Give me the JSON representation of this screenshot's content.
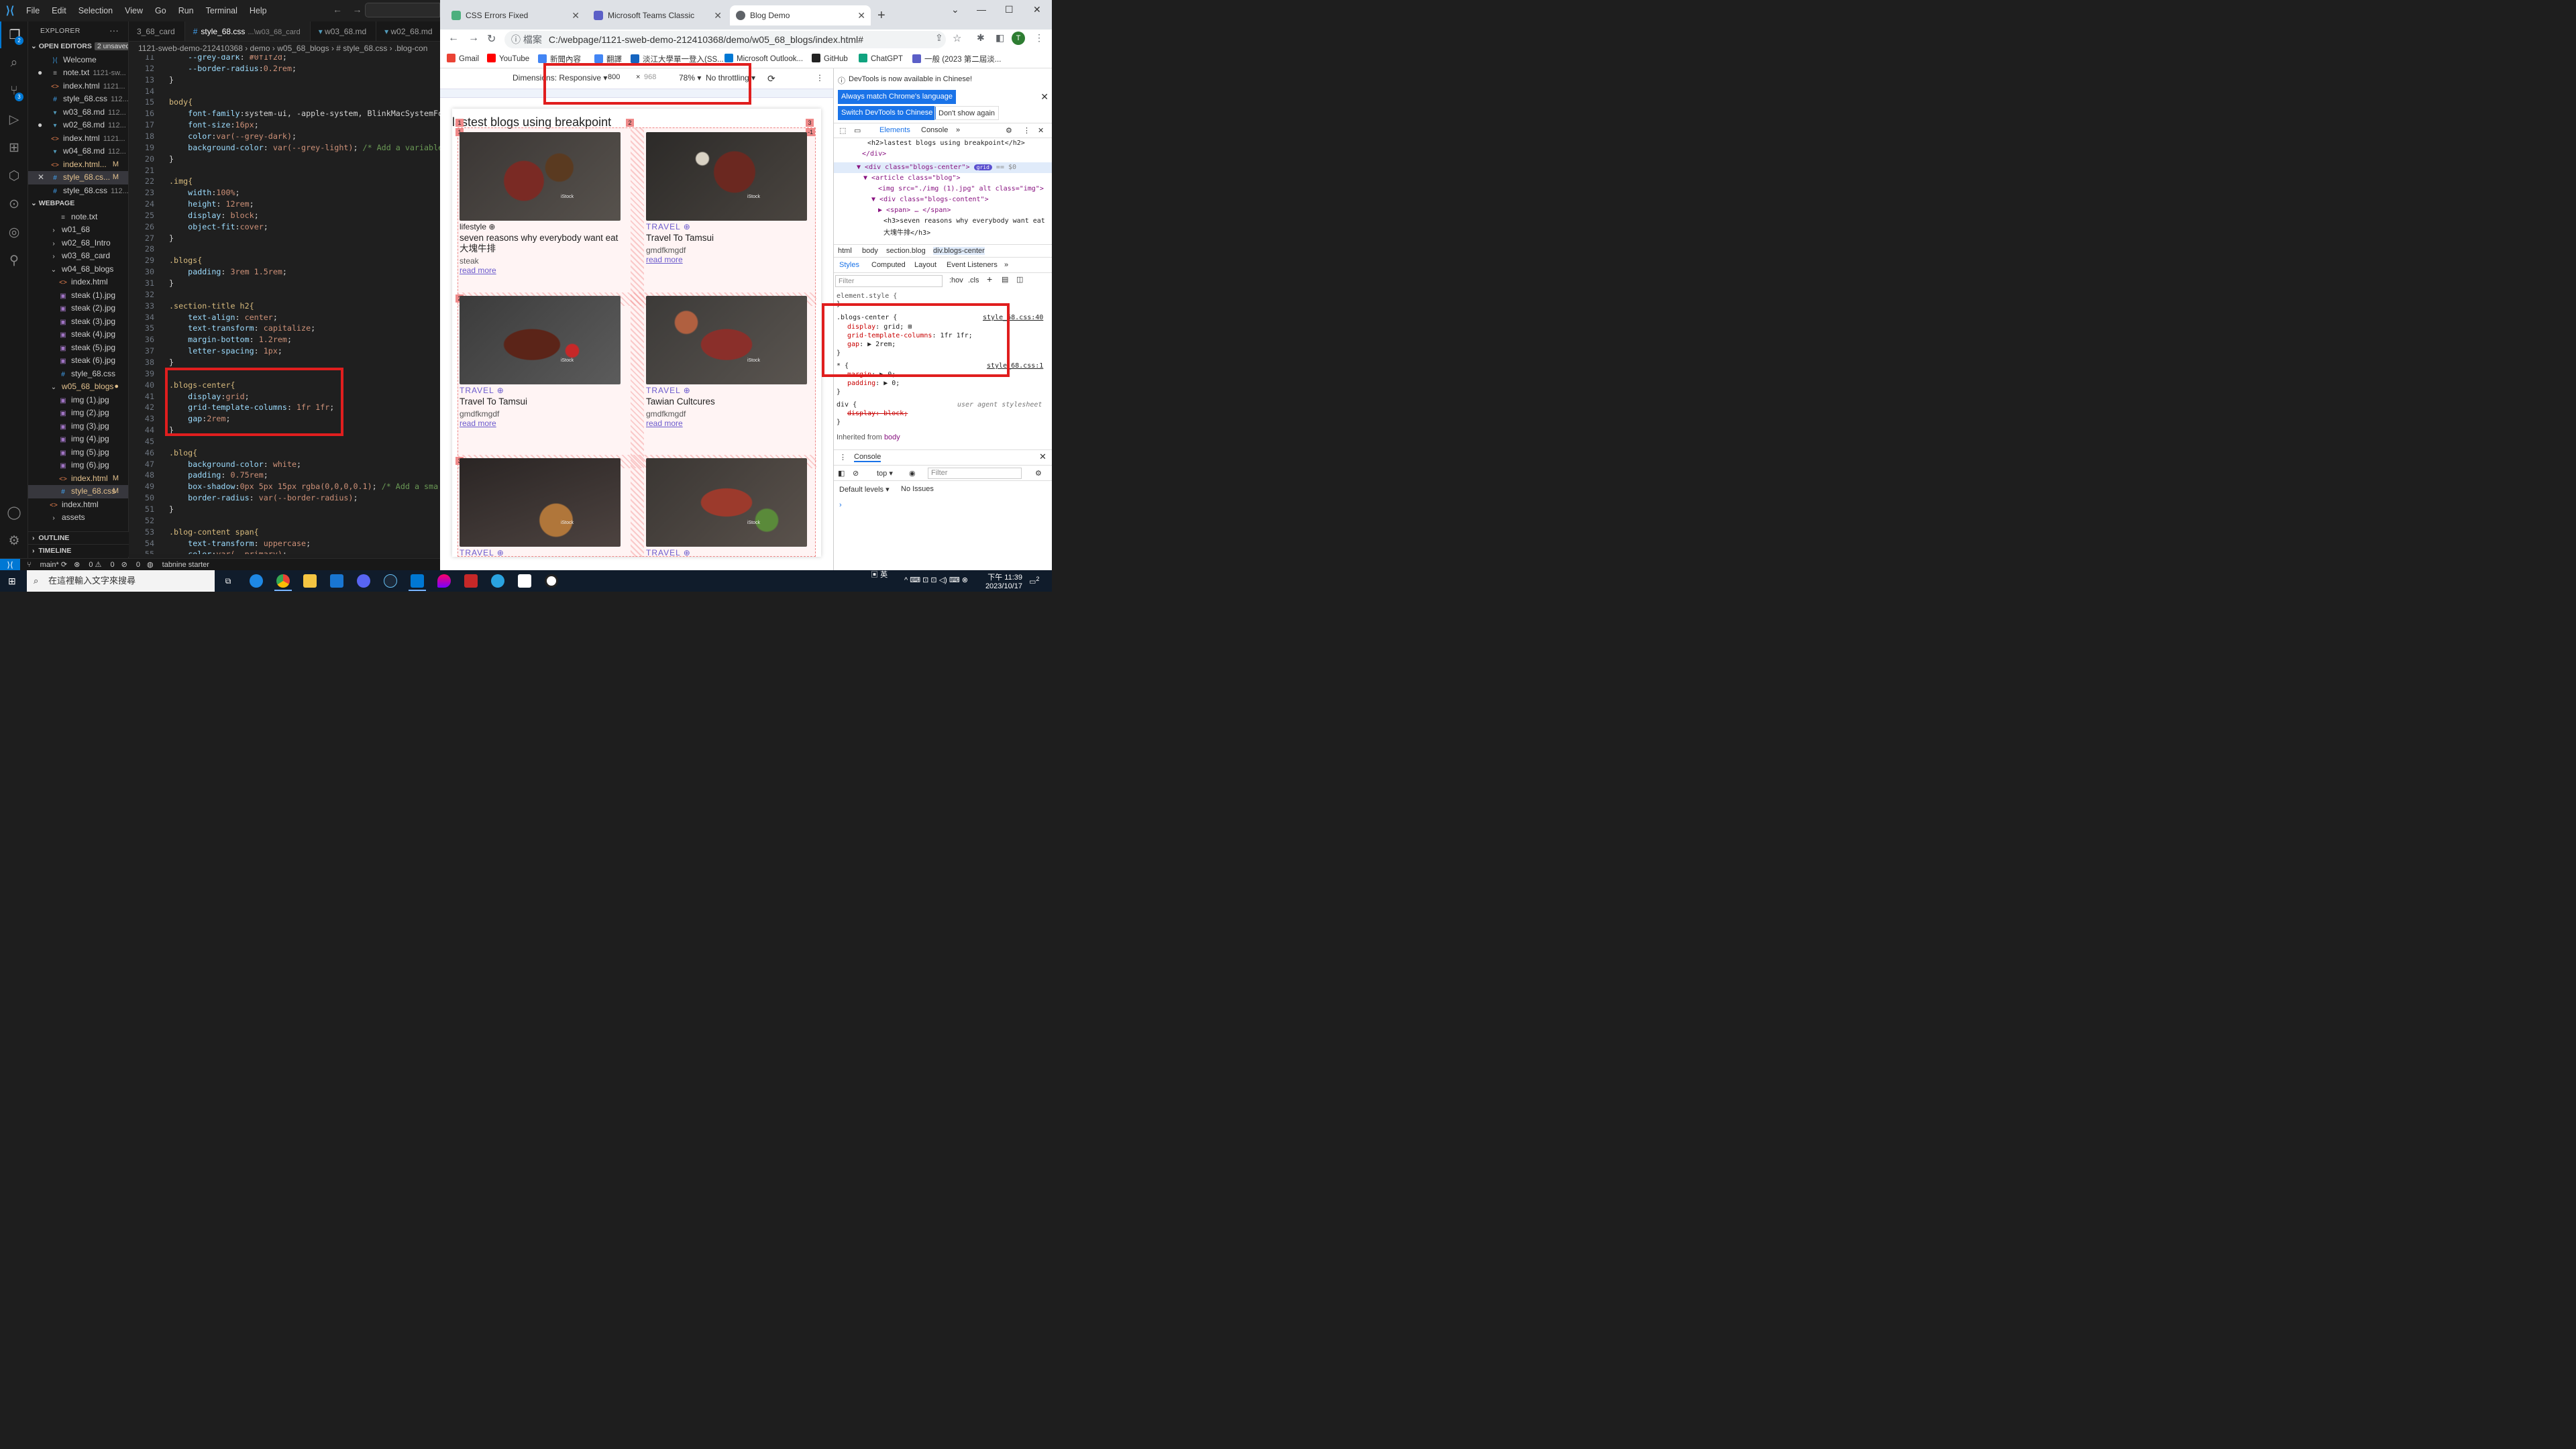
{
  "vscode": {
    "menu": [
      "File",
      "Edit",
      "Selection",
      "View",
      "Go",
      "Run",
      "Terminal",
      "Help"
    ],
    "explorer": {
      "title": "EXPLORER",
      "open_editors_label": "OPEN EDITORS",
      "unsaved_label": "2 unsaved",
      "open_editors": [
        {
          "name": "Welcome",
          "icon": "vscode-icon",
          "desc": "",
          "status": ""
        },
        {
          "name": "note.txt",
          "icon": "txt-icon",
          "desc": "1121-sw...",
          "status": ""
        },
        {
          "name": "index.html",
          "icon": "html-icon",
          "desc": "1121...",
          "status": ""
        },
        {
          "name": "style_68.css",
          "icon": "css-icon",
          "desc": "112...",
          "status": ""
        },
        {
          "name": "w03_68.md",
          "icon": "md-icon",
          "desc": "112...",
          "status": ""
        },
        {
          "name": "w02_68.md",
          "icon": "md-icon",
          "desc": "112...",
          "status": ""
        },
        {
          "name": "index.html",
          "icon": "html-icon",
          "desc": "1121...",
          "status": ""
        },
        {
          "name": "w04_68.md",
          "icon": "md-icon",
          "desc": "112...",
          "status": ""
        },
        {
          "name": "index.html...",
          "icon": "html-icon",
          "desc": "",
          "status": "M"
        },
        {
          "name": "style_68.cs...",
          "icon": "css-icon",
          "desc": "",
          "status": "M"
        },
        {
          "name": "style_68.css",
          "icon": "css-icon",
          "desc": "112...",
          "status": ""
        }
      ],
      "webpage_label": "WEBPAGE",
      "tree": [
        {
          "name": "note.txt",
          "icon": "txt-icon",
          "indent": 2,
          "status": ""
        },
        {
          "name": "w01_68",
          "icon": "folder",
          "indent": 1,
          "status": ""
        },
        {
          "name": "w02_68_Intro",
          "icon": "folder",
          "indent": 1,
          "status": ""
        },
        {
          "name": "w03_68_card",
          "icon": "folder",
          "indent": 1,
          "status": ""
        },
        {
          "name": "w04_68_blogs",
          "icon": "folder-open",
          "indent": 1,
          "status": ""
        },
        {
          "name": "index.html",
          "icon": "html-icon",
          "indent": 2,
          "status": ""
        },
        {
          "name": "steak (1).jpg",
          "icon": "img-icon",
          "indent": 2,
          "status": ""
        },
        {
          "name": "steak (2).jpg",
          "icon": "img-icon",
          "indent": 2,
          "status": ""
        },
        {
          "name": "steak (3).jpg",
          "icon": "img-icon",
          "indent": 2,
          "status": ""
        },
        {
          "name": "steak (4).jpg",
          "icon": "img-icon",
          "indent": 2,
          "status": ""
        },
        {
          "name": "steak (5).jpg",
          "icon": "img-icon",
          "indent": 2,
          "status": ""
        },
        {
          "name": "steak (6).jpg",
          "icon": "img-icon",
          "indent": 2,
          "status": ""
        },
        {
          "name": "style_68.css",
          "icon": "css-icon",
          "indent": 2,
          "status": ""
        },
        {
          "name": "w05_68_blogs",
          "icon": "folder-open",
          "indent": 1,
          "status": ""
        },
        {
          "name": "img (1).jpg",
          "icon": "img-icon",
          "indent": 2,
          "status": ""
        },
        {
          "name": "img (2).jpg",
          "icon": "img-icon",
          "indent": 2,
          "status": ""
        },
        {
          "name": "img (3).jpg",
          "icon": "img-icon",
          "indent": 2,
          "status": ""
        },
        {
          "name": "img (4).jpg",
          "icon": "img-icon",
          "indent": 2,
          "status": ""
        },
        {
          "name": "img (5).jpg",
          "icon": "img-icon",
          "indent": 2,
          "status": ""
        },
        {
          "name": "img (6).jpg",
          "icon": "img-icon",
          "indent": 2,
          "status": ""
        },
        {
          "name": "index.html",
          "icon": "html-icon",
          "indent": 2,
          "status": "M"
        },
        {
          "name": "style_68.css",
          "icon": "css-icon",
          "indent": 2,
          "status": "M"
        },
        {
          "name": "index.html",
          "icon": "html-icon",
          "indent": 1,
          "status": ""
        },
        {
          "name": "assets",
          "icon": "folder",
          "indent": 1,
          "status": ""
        }
      ],
      "outline_label": "OUTLINE",
      "timeline_label": "TIMELINE"
    },
    "tabs": [
      {
        "name": "3_68_card",
        "desc": ""
      },
      {
        "name": "style_68.css",
        "desc": "...\\w03_68_card"
      },
      {
        "name": "w03_68.md",
        "desc": ""
      },
      {
        "name": "w02_68.md",
        "desc": ""
      }
    ],
    "breadcrumb": "1121-sweb-demo-212410368 › demo › w05_68_blogs › # style_68.css › .blog-con",
    "code_lines": [
      {
        "n": "11",
        "t": "    --grey-dark: #0f1f2d;"
      },
      {
        "n": "12",
        "t": "    --border-radius:0.2rem;"
      },
      {
        "n": "13",
        "t": "}"
      },
      {
        "n": "14",
        "t": ""
      },
      {
        "n": "15",
        "t": "body{"
      },
      {
        "n": "16",
        "t": "    font-family:system-ui, -apple-system, BlinkMacSystemFont"
      },
      {
        "n": "17",
        "t": "    font-size:16px;"
      },
      {
        "n": "18",
        "t": "    color:var(--grey-dark);"
      },
      {
        "n": "19",
        "t": "    background-color: var(--grey-light); /* Add a variable"
      },
      {
        "n": "20",
        "t": "}"
      },
      {
        "n": "21",
        "t": ""
      },
      {
        "n": "22",
        "t": ".img{"
      },
      {
        "n": "23",
        "t": "    width:100%;"
      },
      {
        "n": "24",
        "t": "    height: 12rem;"
      },
      {
        "n": "25",
        "t": "    display: block;"
      },
      {
        "n": "26",
        "t": "    object-fit:cover;"
      },
      {
        "n": "27",
        "t": "}"
      },
      {
        "n": "28",
        "t": ""
      },
      {
        "n": "29",
        "t": ".blogs{"
      },
      {
        "n": "30",
        "t": "    padding: 3rem 1.5rem;"
      },
      {
        "n": "31",
        "t": "}"
      },
      {
        "n": "32",
        "t": ""
      },
      {
        "n": "33",
        "t": ".section-title h2{"
      },
      {
        "n": "34",
        "t": "    text-align: center;"
      },
      {
        "n": "35",
        "t": "    text-transform: capitalize;"
      },
      {
        "n": "36",
        "t": "    margin-bottom: 1.2rem;"
      },
      {
        "n": "37",
        "t": "    letter-spacing: 1px;"
      },
      {
        "n": "38",
        "t": "}"
      },
      {
        "n": "39",
        "t": ""
      },
      {
        "n": "40",
        "t": ".blogs-center{"
      },
      {
        "n": "41",
        "t": "    display:grid;"
      },
      {
        "n": "42",
        "t": "    grid-template-columns: 1fr 1fr;"
      },
      {
        "n": "43",
        "t": "    gap:2rem;"
      },
      {
        "n": "44",
        "t": "}"
      },
      {
        "n": "45",
        "t": ""
      },
      {
        "n": "46",
        "t": ".blog{"
      },
      {
        "n": "47",
        "t": "    background-color: white;"
      },
      {
        "n": "48",
        "t": "    padding: 0.75rem;"
      },
      {
        "n": "49",
        "t": "    box-shadow:0px 5px 15px rgba(0,0,0,0.1); /* Add a sma"
      },
      {
        "n": "50",
        "t": "    border-radius: var(--border-radius);"
      },
      {
        "n": "51",
        "t": "}"
      },
      {
        "n": "52",
        "t": ""
      },
      {
        "n": "53",
        "t": ".blog-content span{"
      },
      {
        "n": "54",
        "t": "    text-transform: uppercase;"
      },
      {
        "n": "55",
        "t": "    color:var(--primary);"
      }
    ],
    "status": {
      "branch": "main*",
      "errors": "0",
      "warnings": "0",
      "ports": "0",
      "extension": "tabnine starter"
    }
  },
  "chrome": {
    "tabs": [
      {
        "title": "CSS Errors Fixed",
        "active": false,
        "color": "#4caf7d"
      },
      {
        "title": "Microsoft Teams Classic",
        "active": false,
        "color": "#5b5fc7"
      },
      {
        "title": "Blog Demo",
        "active": true,
        "color": "#5f6368"
      }
    ],
    "address_label": "檔案",
    "url": "C:/webpage/1121-sweb-demo-212410368/demo/w05_68_blogs/index.html#",
    "profile_initial": "T",
    "bookmarks": [
      {
        "label": "Gmail",
        "color": "#ea4335"
      },
      {
        "label": "YouTube",
        "color": "#ff0000"
      },
      {
        "label": "新聞內容",
        "color": "#4285f4"
      },
      {
        "label": "翻譯",
        "color": "#4285f4"
      },
      {
        "label": "淡江大學單一登入(SS...",
        "color": "#1565c0"
      },
      {
        "label": "Microsoft Outlook...",
        "color": "#0078d4"
      },
      {
        "label": "GitHub",
        "color": "#222222"
      },
      {
        "label": "ChatGPT",
        "color": "#10a37f"
      },
      {
        "label": "一般 (2023 第二屆淡...",
        "color": "#5b5fc7"
      }
    ],
    "device_toolbar": {
      "dimensions_label": "Dimensions: Responsive",
      "width": "800",
      "height": "968",
      "zoom": "78%",
      "throttle": "No throttling"
    },
    "page": {
      "title": "lastest blogs using breakpoint",
      "grid_numbers": [
        "1",
        "2",
        "3",
        "1",
        "2",
        "3",
        "-1"
      ],
      "cards": [
        {
          "category": "lifestyle",
          "title": "seven reasons why everybody want eat 大塊牛排",
          "sub": "steak",
          "more": "read more",
          "lower": true
        },
        {
          "category": "TRAVEL",
          "title": "Travel To Tamsui",
          "sub": "gmdfkmgdf",
          "more": "read more",
          "lower": false
        },
        {
          "category": "TRAVEL",
          "title": "Travel To Tamsui",
          "sub": "gmdfkmgdf",
          "more": "read more",
          "lower": false
        },
        {
          "category": "TRAVEL",
          "title": "Tawian Cultcures",
          "sub": "gmdfkmgdf",
          "more": "read more",
          "lower": false
        },
        {
          "category": "TRAVEL",
          "title": "",
          "sub": "",
          "more": "",
          "lower": false
        },
        {
          "category": "TRAVEL",
          "title": "",
          "sub": "",
          "more": "",
          "lower": false
        }
      ]
    },
    "devtools": {
      "notice": "DevTools is now available in Chinese!",
      "btn_match": "Always match Chrome's language",
      "btn_switch": "Switch DevTools to Chinese",
      "btn_dont": "Don't show again",
      "tabs": [
        "Elements",
        "Console"
      ],
      "dom_lines": [
        "<h2>lastest blogs using breakpoint</h2>",
        "</div>",
        "<div class=\"blogs-center\">",
        "<article class=\"blog\">",
        "<img src=\"./img (1).jpg\" alt class=\"img\">",
        "<div class=\"blogs-content\">",
        "<span> … </span>",
        "<h3>seven reasons why everybody want eat",
        "大塊牛排</h3>"
      ],
      "dom_badge": "grid",
      "dom_ref": "== $0",
      "crumbs": [
        "html",
        "body",
        "section.blog",
        "div.blogs-center"
      ],
      "style_tabs": [
        "Styles",
        "Computed",
        "Layout",
        "Event Listeners"
      ],
      "filter_placeholder": "Filter",
      "hov": ":hov",
      "cls": ".cls",
      "element_style": "element.style {",
      "rule_selector": ".blogs-center {",
      "rule_source": "style_68.css:40",
      "rule_props": [
        {
          "p": "display",
          "v": "grid;"
        },
        {
          "p": "grid-template-columns",
          "v": "1fr 1fr;"
        },
        {
          "p": "gap",
          "v": "▶ 2rem;"
        }
      ],
      "star_selector": "* {",
      "star_source": "style_68.css:1",
      "star_props": [
        {
          "p": "margin",
          "v": "▶ 0;"
        },
        {
          "p": "padding",
          "v": "▶ 0;"
        }
      ],
      "div_selector": "div {",
      "ua_label": "user agent stylesheet",
      "div_prop": "display: block;",
      "inherited": "Inherited from",
      "inherited_el": "body",
      "console_title": "Console",
      "console_top": "top",
      "console_filter": "Filter",
      "console_levels": "Default levels",
      "console_issues": "No Issues"
    }
  },
  "taskbar": {
    "search_placeholder": "在這裡輸入文字來搜尋",
    "ime": "英",
    "time": "下午 11:39",
    "date": "2023/10/17",
    "notif_count": "2"
  }
}
